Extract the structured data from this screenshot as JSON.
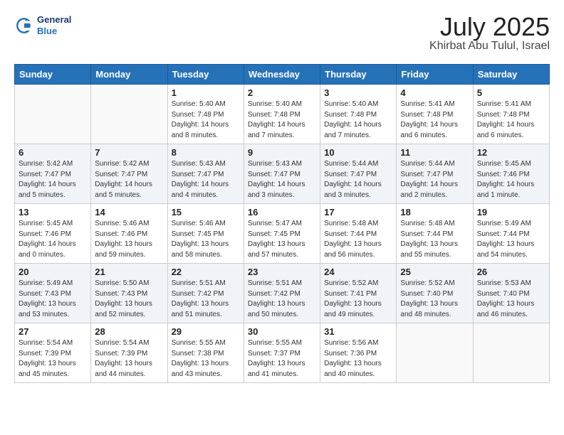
{
  "header": {
    "logo_general": "General",
    "logo_blue": "Blue",
    "title": "July 2025",
    "subtitle": "Khirbat Abu Tulul, Israel"
  },
  "weekdays": [
    "Sunday",
    "Monday",
    "Tuesday",
    "Wednesday",
    "Thursday",
    "Friday",
    "Saturday"
  ],
  "weeks": [
    [
      {
        "num": "",
        "detail": ""
      },
      {
        "num": "",
        "detail": ""
      },
      {
        "num": "1",
        "detail": "Sunrise: 5:40 AM\nSunset: 7:48 PM\nDaylight: 14 hours\nand 8 minutes."
      },
      {
        "num": "2",
        "detail": "Sunrise: 5:40 AM\nSunset: 7:48 PM\nDaylight: 14 hours\nand 7 minutes."
      },
      {
        "num": "3",
        "detail": "Sunrise: 5:40 AM\nSunset: 7:48 PM\nDaylight: 14 hours\nand 7 minutes."
      },
      {
        "num": "4",
        "detail": "Sunrise: 5:41 AM\nSunset: 7:48 PM\nDaylight: 14 hours\nand 6 minutes."
      },
      {
        "num": "5",
        "detail": "Sunrise: 5:41 AM\nSunset: 7:48 PM\nDaylight: 14 hours\nand 6 minutes."
      }
    ],
    [
      {
        "num": "6",
        "detail": "Sunrise: 5:42 AM\nSunset: 7:47 PM\nDaylight: 14 hours\nand 5 minutes."
      },
      {
        "num": "7",
        "detail": "Sunrise: 5:42 AM\nSunset: 7:47 PM\nDaylight: 14 hours\nand 5 minutes."
      },
      {
        "num": "8",
        "detail": "Sunrise: 5:43 AM\nSunset: 7:47 PM\nDaylight: 14 hours\nand 4 minutes."
      },
      {
        "num": "9",
        "detail": "Sunrise: 5:43 AM\nSunset: 7:47 PM\nDaylight: 14 hours\nand 3 minutes."
      },
      {
        "num": "10",
        "detail": "Sunrise: 5:44 AM\nSunset: 7:47 PM\nDaylight: 14 hours\nand 3 minutes."
      },
      {
        "num": "11",
        "detail": "Sunrise: 5:44 AM\nSunset: 7:47 PM\nDaylight: 14 hours\nand 2 minutes."
      },
      {
        "num": "12",
        "detail": "Sunrise: 5:45 AM\nSunset: 7:46 PM\nDaylight: 14 hours\nand 1 minute."
      }
    ],
    [
      {
        "num": "13",
        "detail": "Sunrise: 5:45 AM\nSunset: 7:46 PM\nDaylight: 14 hours\nand 0 minutes."
      },
      {
        "num": "14",
        "detail": "Sunrise: 5:46 AM\nSunset: 7:46 PM\nDaylight: 13 hours\nand 59 minutes."
      },
      {
        "num": "15",
        "detail": "Sunrise: 5:46 AM\nSunset: 7:45 PM\nDaylight: 13 hours\nand 58 minutes."
      },
      {
        "num": "16",
        "detail": "Sunrise: 5:47 AM\nSunset: 7:45 PM\nDaylight: 13 hours\nand 57 minutes."
      },
      {
        "num": "17",
        "detail": "Sunrise: 5:48 AM\nSunset: 7:44 PM\nDaylight: 13 hours\nand 56 minutes."
      },
      {
        "num": "18",
        "detail": "Sunrise: 5:48 AM\nSunset: 7:44 PM\nDaylight: 13 hours\nand 55 minutes."
      },
      {
        "num": "19",
        "detail": "Sunrise: 5:49 AM\nSunset: 7:44 PM\nDaylight: 13 hours\nand 54 minutes."
      }
    ],
    [
      {
        "num": "20",
        "detail": "Sunrise: 5:49 AM\nSunset: 7:43 PM\nDaylight: 13 hours\nand 53 minutes."
      },
      {
        "num": "21",
        "detail": "Sunrise: 5:50 AM\nSunset: 7:43 PM\nDaylight: 13 hours\nand 52 minutes."
      },
      {
        "num": "22",
        "detail": "Sunrise: 5:51 AM\nSunset: 7:42 PM\nDaylight: 13 hours\nand 51 minutes."
      },
      {
        "num": "23",
        "detail": "Sunrise: 5:51 AM\nSunset: 7:42 PM\nDaylight: 13 hours\nand 50 minutes."
      },
      {
        "num": "24",
        "detail": "Sunrise: 5:52 AM\nSunset: 7:41 PM\nDaylight: 13 hours\nand 49 minutes."
      },
      {
        "num": "25",
        "detail": "Sunrise: 5:52 AM\nSunset: 7:40 PM\nDaylight: 13 hours\nand 48 minutes."
      },
      {
        "num": "26",
        "detail": "Sunrise: 5:53 AM\nSunset: 7:40 PM\nDaylight: 13 hours\nand 46 minutes."
      }
    ],
    [
      {
        "num": "27",
        "detail": "Sunrise: 5:54 AM\nSunset: 7:39 PM\nDaylight: 13 hours\nand 45 minutes."
      },
      {
        "num": "28",
        "detail": "Sunrise: 5:54 AM\nSunset: 7:39 PM\nDaylight: 13 hours\nand 44 minutes."
      },
      {
        "num": "29",
        "detail": "Sunrise: 5:55 AM\nSunset: 7:38 PM\nDaylight: 13 hours\nand 43 minutes."
      },
      {
        "num": "30",
        "detail": "Sunrise: 5:55 AM\nSunset: 7:37 PM\nDaylight: 13 hours\nand 41 minutes."
      },
      {
        "num": "31",
        "detail": "Sunrise: 5:56 AM\nSunset: 7:36 PM\nDaylight: 13 hours\nand 40 minutes."
      },
      {
        "num": "",
        "detail": ""
      },
      {
        "num": "",
        "detail": ""
      }
    ]
  ]
}
